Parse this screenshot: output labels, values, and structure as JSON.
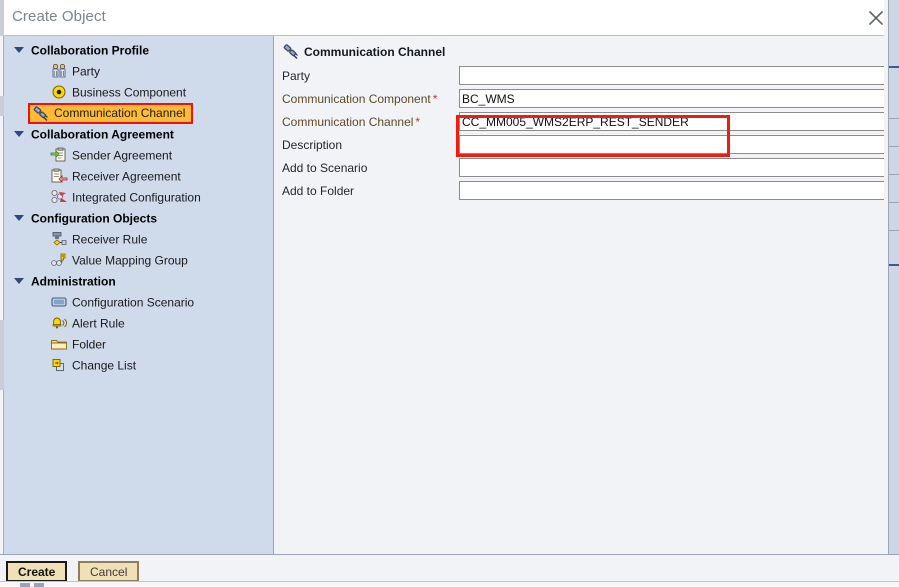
{
  "window": {
    "title": "Create Object",
    "close_icon": "close-icon"
  },
  "tree": {
    "groups": [
      {
        "label": "Collaboration Profile",
        "icon": "caret-down-icon",
        "items": [
          {
            "label": "Party",
            "icon": "party-icon",
            "selected": false
          },
          {
            "label": "Business Component",
            "icon": "business-component-icon",
            "selected": false
          },
          {
            "label": "Communication Channel",
            "icon": "communication-channel-icon",
            "selected": true
          }
        ]
      },
      {
        "label": "Collaboration Agreement",
        "icon": "caret-down-icon",
        "items": [
          {
            "label": "Sender Agreement",
            "icon": "sender-agreement-icon",
            "selected": false
          },
          {
            "label": "Receiver Agreement",
            "icon": "receiver-agreement-icon",
            "selected": false
          },
          {
            "label": "Integrated Configuration",
            "icon": "integrated-configuration-icon",
            "selected": false
          }
        ]
      },
      {
        "label": "Configuration Objects",
        "icon": "caret-down-icon",
        "items": [
          {
            "label": "Receiver Rule",
            "icon": "receiver-rule-icon",
            "selected": false
          },
          {
            "label": "Value Mapping Group",
            "icon": "value-mapping-group-icon",
            "selected": false
          }
        ]
      },
      {
        "label": "Administration",
        "icon": "caret-down-icon",
        "items": [
          {
            "label": "Configuration Scenario",
            "icon": "configuration-scenario-icon",
            "selected": false
          },
          {
            "label": "Alert Rule",
            "icon": "alert-rule-icon",
            "selected": false
          },
          {
            "label": "Folder",
            "icon": "folder-icon",
            "selected": false
          },
          {
            "label": "Change List",
            "icon": "change-list-icon",
            "selected": false
          }
        ]
      }
    ]
  },
  "content": {
    "section_title": "Communication Channel",
    "section_icon": "communication-channel-icon",
    "fields": [
      {
        "label": "Party",
        "required": false,
        "value": "",
        "placeholder": ""
      },
      {
        "label": "Communication Component",
        "required": true,
        "value": "BC_WMS",
        "placeholder": ""
      },
      {
        "label": "Communication Channel",
        "required": true,
        "value": "CC_MM005_WMS2ERP_REST_SENDER",
        "placeholder": ""
      },
      {
        "label": "Description",
        "required": false,
        "value": "",
        "placeholder": ""
      },
      {
        "label": "Add to Scenario",
        "required": false,
        "value": "",
        "placeholder": ""
      },
      {
        "label": "Add to Folder",
        "required": false,
        "value": "",
        "placeholder": ""
      }
    ],
    "required_marker": "*"
  },
  "footer": {
    "create_label": "Create",
    "cancel_label": "Cancel"
  },
  "colors": {
    "tree_background": "#cfdaea",
    "content_background": "#f2f3f7",
    "selection_highlight": "#ffbb33",
    "annotation_red": "#ee1c11",
    "required_label": "#5f4a26",
    "required_star": "#c0392b",
    "button_face": "#f0e0b5",
    "title_text": "#7c8391"
  }
}
